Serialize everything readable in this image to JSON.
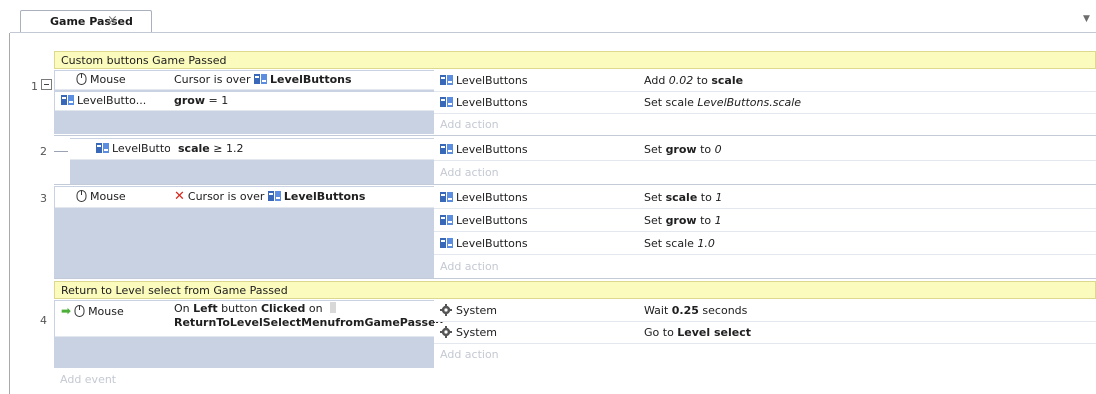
{
  "tab": {
    "label": "Game Passed"
  },
  "groups": [
    {
      "label": "Custom buttons Game Passed"
    },
    {
      "label": "Return to Level select from Game Passed"
    }
  ],
  "events": [
    {
      "number": "1",
      "conditions": [
        {
          "object": "Mouse",
          "text_pre": "Cursor is over",
          "target": "LevelButtons"
        },
        {
          "object": "LevelButto...",
          "param": "grow",
          "op": " = 1"
        }
      ],
      "actions": [
        {
          "object": "LevelButtons",
          "pre": "Add ",
          "val": "0.02",
          "mid": " to ",
          "bold": "scale",
          "post": ""
        },
        {
          "object": "LevelButtons",
          "pre": "Set scale ",
          "val": "LevelButtons.scale",
          "mid": "",
          "bold": "",
          "post": ""
        }
      ],
      "add_action": "Add action"
    },
    {
      "number": "2",
      "conditions": [
        {
          "object": "LevelButto...",
          "param": "scale",
          "op": " ≥ 1.2"
        }
      ],
      "actions": [
        {
          "object": "LevelButtons",
          "pre": "Set ",
          "bold": "grow",
          "mid": " to ",
          "val": "0"
        }
      ],
      "add_action": "Add action"
    },
    {
      "number": "3",
      "conditions": [
        {
          "object": "Mouse",
          "text_pre": "Cursor is over",
          "target": "LevelButtons"
        }
      ],
      "actions": [
        {
          "object": "LevelButtons",
          "pre": "Set ",
          "bold": "scale",
          "mid": " to ",
          "val": "1"
        },
        {
          "object": "LevelButtons",
          "pre": "Set ",
          "bold": "grow",
          "mid": " to ",
          "val": "1"
        },
        {
          "object": "LevelButtons",
          "pre": "Set scale ",
          "bold": "",
          "mid": "",
          "val": "1.0"
        }
      ],
      "add_action": "Add action"
    },
    {
      "number": "4",
      "conditions": [
        {
          "object": "Mouse",
          "line1_pre": "On ",
          "line1_bold1": "Left",
          "line1_mid": " button ",
          "line1_bold2": "Clicked",
          "line1_post": " on",
          "line2_bold": "ReturnToLevelSelectMenufromGamePassed"
        }
      ],
      "actions": [
        {
          "object": "System",
          "pre": "Wait ",
          "bold": "0.25",
          "post": " seconds"
        },
        {
          "object": "System",
          "pre": "Go to ",
          "bold": "Level select",
          "post": ""
        }
      ],
      "add_action": "Add action"
    }
  ],
  "add_event": "Add event",
  "colors": {
    "group_bg": "#fbfbbd",
    "condition_bg": "#c8d2e2",
    "invert_icon": "#d8261c",
    "trigger_arrow": "#4caf3a"
  }
}
